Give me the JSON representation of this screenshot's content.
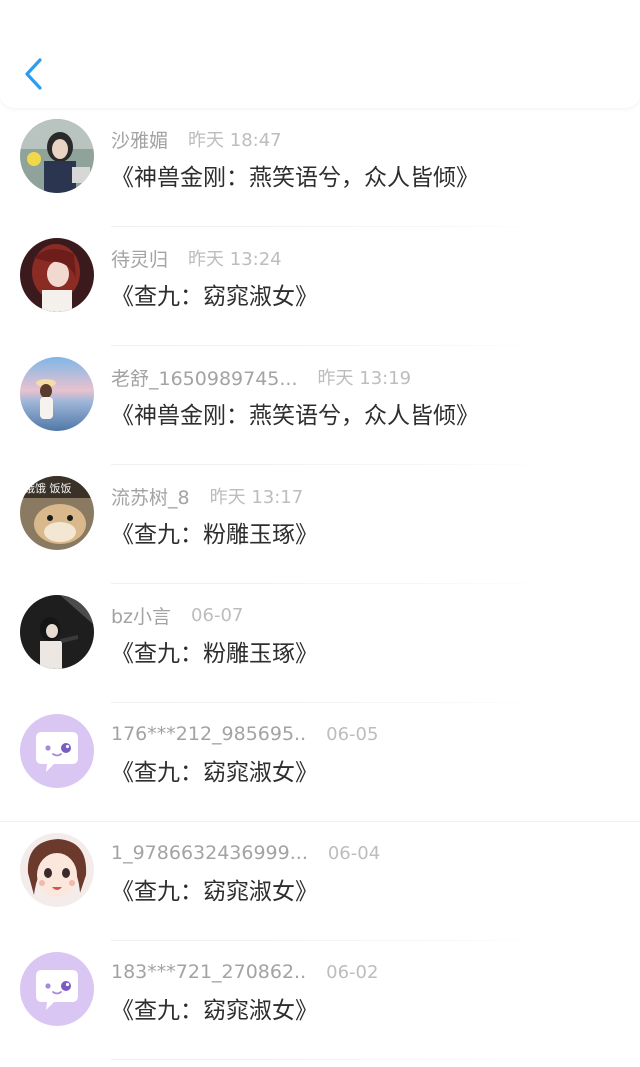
{
  "header": {
    "back_icon": "chevron-left-icon",
    "accent_color": "#2c9cf0"
  },
  "comments": [
    {
      "name": "沙雅媚",
      "time": "昨天 18:47",
      "title": "《神兽金刚：燕笑语兮，众人皆倾》",
      "avatar": "photo-avatar"
    },
    {
      "name": "待灵归",
      "time": "昨天 13:24",
      "title": "《查九：窈窕淑女》",
      "avatar": "anime-avatar"
    },
    {
      "name": "老舒_1650989745...",
      "time": "昨天 13:19",
      "title": "《神兽金刚：燕笑语兮，众人皆倾》",
      "avatar": "sky-avatar"
    },
    {
      "name": "流苏树_8",
      "time": "昨天 13:17",
      "title": "《查九：粉雕玉琢》",
      "avatar": "hamster-avatar"
    },
    {
      "name": "bz小言",
      "time": "06-07",
      "title": "《查九：粉雕玉琢》",
      "avatar": "dark-photo-avatar"
    },
    {
      "name": "176***212_985695..",
      "time": "06-05",
      "title": "《查九：窈窕淑女》",
      "avatar": "default-chat-avatar"
    },
    {
      "name": "1_9786632436999...",
      "time": "06-04",
      "title": "《查九：窈窕淑女》",
      "avatar": "cartoon-girl-avatar"
    },
    {
      "name": "183***721_270862..",
      "time": "06-02",
      "title": "《查九：窈窕淑女》",
      "avatar": "default-chat-avatar"
    }
  ],
  "colors": {
    "default_avatar_bg": "#d9c6f3",
    "name": "#a3a3a3",
    "time": "#bdbdbd",
    "title": "#2e2e2e"
  }
}
